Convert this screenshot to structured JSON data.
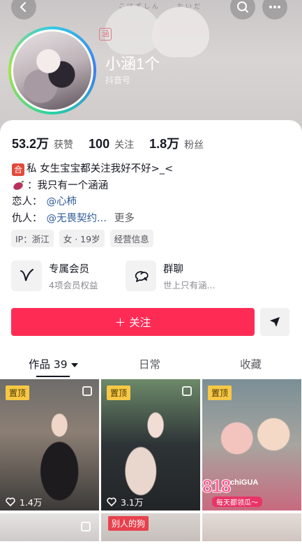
{
  "header": {
    "banner_text": "こほずしん　　たいだ",
    "banner_seal": "涵",
    "nickname": "小涵1个",
    "douyin_id_label": "抖音号"
  },
  "stats": [
    {
      "value": "53.2万",
      "label": "获赞"
    },
    {
      "value": "100",
      "label": "关注"
    },
    {
      "value": "1.8万",
      "label": "粉丝"
    }
  ],
  "bio": {
    "line1_badge": "合",
    "line1_text": "私 女生宝宝都关注我好不好>_<",
    "line2_text": "：我只有一个涵涵",
    "line3_label": "恋人：",
    "line3_mention": "@心柿",
    "line4_label": "仇人：",
    "line4_mention": "@无畏契约...",
    "more": "更多"
  },
  "chips": [
    "IP：浙江",
    "女 · 19岁",
    "经营信息"
  ],
  "services": [
    {
      "title": "专属会员",
      "subtitle": "4项会员权益",
      "icon": "membership-v-icon"
    },
    {
      "title": "群聊",
      "subtitle": "世上只有涵...",
      "icon": "group-chat-icon"
    }
  ],
  "actions": {
    "follow": "＋ 关注",
    "share_icon": "send-icon"
  },
  "tabs": [
    {
      "label": "作品 39",
      "active": true
    },
    {
      "label": "日常",
      "active": false
    },
    {
      "label": "收藏",
      "active": false
    }
  ],
  "videos": [
    {
      "badge": "置顶",
      "likes": "1.4万"
    },
    {
      "badge": "置顶",
      "likes": "3.1万"
    },
    {
      "badge": "置顶",
      "promo_big": "818",
      "promo_brand": "chiGUA",
      "promo_sub": "每天都领瓜～"
    },
    {
      "badge": ""
    },
    {
      "badge": "别人的狗"
    },
    {
      "badge": ""
    }
  ],
  "colors": {
    "accent": "#fe2c55",
    "pin": "#f7c845",
    "mention": "#2f5b9a"
  }
}
